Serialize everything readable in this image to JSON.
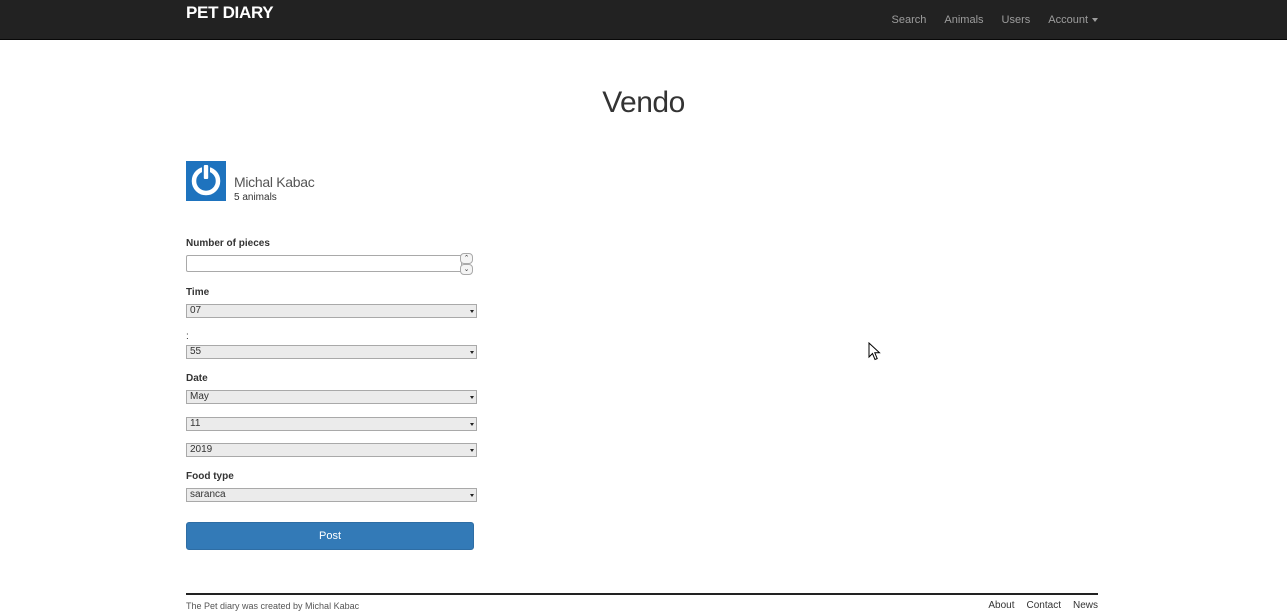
{
  "navbar": {
    "brand": "PET DIARY",
    "links": [
      "Search",
      "Animals",
      "Users"
    ],
    "account_label": "Account"
  },
  "page": {
    "title": "Vendo"
  },
  "user": {
    "name": "Michal Kabac",
    "count": "5 animals"
  },
  "form": {
    "pieces_label": "Number of pieces",
    "pieces_value": "",
    "time_label": "Time",
    "hour_value": "07",
    "colon_label": ":",
    "minute_value": "55",
    "date_label": "Date",
    "month_value": "May",
    "day_value": "11",
    "year_value": "2019",
    "food_label": "Food type",
    "food_value": "saranca",
    "submit_label": "Post"
  },
  "footer": {
    "credit": "The Pet diary was created by Michal Kabac",
    "links": [
      "About",
      "Contact",
      "News"
    ]
  },
  "colors": {
    "navbar_bg": "#222222",
    "primary": "#337ab7",
    "avatar_bg": "#1e73be"
  },
  "icons": {
    "avatar": "power-icon",
    "account_caret": "caret-down-icon",
    "cursor": "mouse-pointer-icon"
  }
}
